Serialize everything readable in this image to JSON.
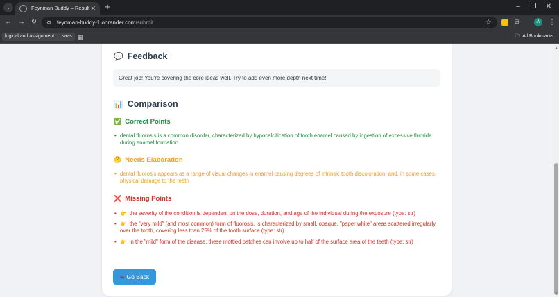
{
  "browser": {
    "tab_title": "Feynman Buddy – Result",
    "url_host": "feynman-buddy-1.onrender.com",
    "url_path": "/submit",
    "profile_initial": "A",
    "bookmarks": [
      "logical and assignment...",
      "saas"
    ],
    "all_bookmarks": "All Bookmarks"
  },
  "page": {
    "feedback": {
      "heading": "Feedback",
      "icon": "speech-balloon-icon",
      "text": "Great job! You're covering the core ideas well. Try to add even more depth next time!"
    },
    "comparison": {
      "heading": "Comparison",
      "icon": "bar-chart-icon"
    },
    "correct": {
      "heading": "Correct Points",
      "icon": "check-mark-icon",
      "color": "#1e8e3e",
      "items": [
        "dental fluorosis is a common disorder, characterized by hypocalcification of tooth enamel caused by ingestion of excessive fluoride during enamel formation"
      ]
    },
    "elaboration": {
      "heading": "Needs Elaboration",
      "icon": "thinking-face-icon",
      "color": "#f0a020",
      "items": [
        "dental fluorosis appears as a range of visual changes in enamel causing degrees of intrinsic tooth discoloration, and, in some cases, physical damage to the teeth"
      ]
    },
    "missing": {
      "heading": "Missing Points",
      "icon": "cross-mark-icon",
      "color": "#d93025",
      "items": [
        "the severity of the condition is dependent on the dose, duration, and age of the individual during the exposure (type: str)",
        "the \"very mild\" (and most common) form of fluorosis, is characterized by small, opaque, \"paper white\" areas scattered irregularly over the tooth, covering less than 25% of the tooth surface (type: str)",
        "in the \"mild\" form of the disease, these mottled patches can involve up to half of the surface area of the teeth (type: str)"
      ]
    },
    "back_button": "Go Back"
  }
}
